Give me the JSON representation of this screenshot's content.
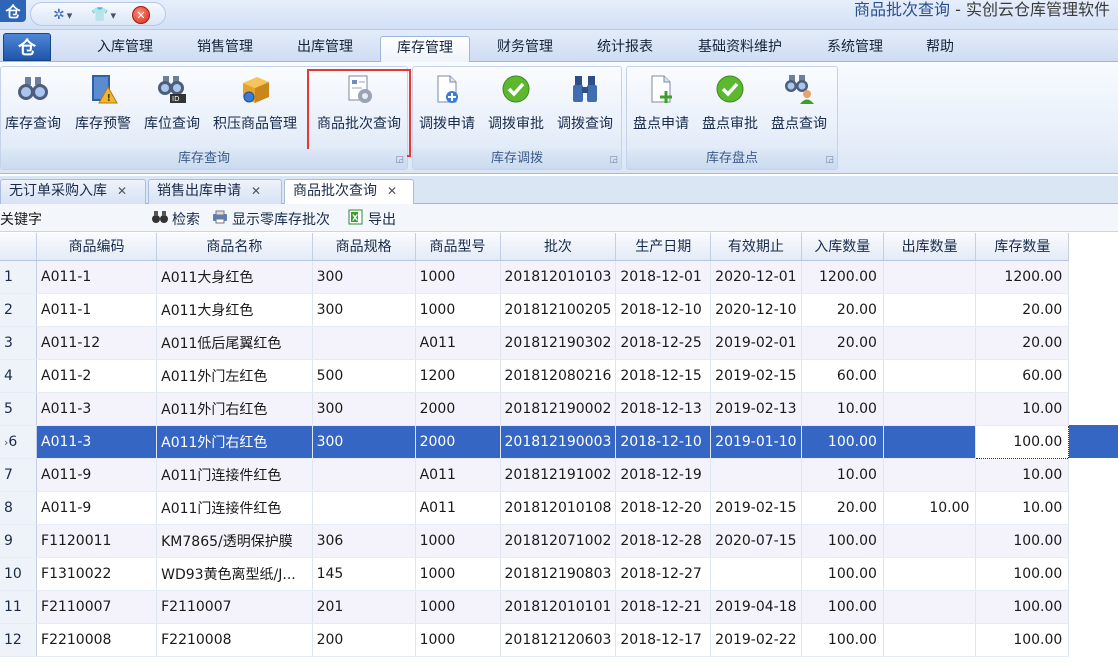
{
  "titlebar": {
    "logo": "仓",
    "title_main": "商品批次查询",
    "title_sub": " - 实创云仓库管理软件"
  },
  "menubar": {
    "app_logo": "仓",
    "tabs": [
      {
        "label": "入库管理"
      },
      {
        "label": "销售管理"
      },
      {
        "label": "出库管理"
      },
      {
        "label": "库存管理"
      },
      {
        "label": "财务管理"
      },
      {
        "label": "统计报表"
      },
      {
        "label": "基础资料维护"
      },
      {
        "label": "系统管理"
      },
      {
        "label": "帮助"
      }
    ],
    "active": "库存管理"
  },
  "ribbon": {
    "groups": [
      {
        "label": "库存查询",
        "buttons": [
          {
            "label": "库存查询",
            "icon": "binoculars-icon"
          },
          {
            "label": "库存预警",
            "icon": "warning-book-icon"
          },
          {
            "label": "库位查询",
            "icon": "binoculars-id-icon"
          },
          {
            "label": "积压商品管理",
            "icon": "box-icon"
          },
          {
            "label": "商品批次查询",
            "icon": "gear-document-icon"
          }
        ]
      },
      {
        "label": "库存调拨",
        "buttons": [
          {
            "label": "调拨申请",
            "icon": "add-document-icon"
          },
          {
            "label": "调拨审批",
            "icon": "check-circle-icon"
          },
          {
            "label": "调拨查询",
            "icon": "binoculars-icon"
          }
        ]
      },
      {
        "label": "库存盘点",
        "buttons": [
          {
            "label": "盘点申请",
            "icon": "add-document-icon"
          },
          {
            "label": "盘点审批",
            "icon": "check-circle-icon"
          },
          {
            "label": "盘点查询",
            "icon": "binoculars-person-icon"
          }
        ]
      }
    ]
  },
  "doctabs": [
    {
      "label": "无订单采购入库"
    },
    {
      "label": "销售出库申请"
    },
    {
      "label": "商品批次查询"
    }
  ],
  "toolbar": {
    "keyword_label": "关键字",
    "keyword_value": "",
    "search_label": "检索",
    "zero_stock_label": "显示零库存批次",
    "export_label": "导出"
  },
  "grid": {
    "columns": [
      "商品编码",
      "商品名称",
      "商品规格",
      "商品型号",
      "批次",
      "生产日期",
      "有效期止",
      "入库数量",
      "出库数量",
      "库存数量"
    ],
    "rows": [
      {
        "idx": "1",
        "cells": [
          "A011-1",
          "A011大身红色",
          "300",
          "1000",
          "201812010103",
          "2018-12-01",
          "2020-12-01",
          "1200.00",
          "",
          "1200.00"
        ]
      },
      {
        "idx": "2",
        "cells": [
          "A011-1",
          "A011大身红色",
          "300",
          "1000",
          "201812100205",
          "2018-12-10",
          "2020-12-10",
          "20.00",
          "",
          "20.00"
        ]
      },
      {
        "idx": "3",
        "cells": [
          "A011-12",
          "A011低后尾翼红色",
          "",
          "A011",
          "201812190302",
          "2018-12-25",
          "2019-02-01",
          "20.00",
          "",
          "20.00"
        ]
      },
      {
        "idx": "4",
        "cells": [
          "A011-2",
          "A011外门左红色",
          "500",
          "1200",
          "201812080216",
          "2018-12-15",
          "2019-02-15",
          "60.00",
          "",
          "60.00"
        ]
      },
      {
        "idx": "5",
        "cells": [
          "A011-3",
          "A011外门右红色",
          "300",
          "2000",
          "201812190002",
          "2018-12-13",
          "2019-02-13",
          "10.00",
          "",
          "10.00"
        ]
      },
      {
        "idx": "6",
        "cells": [
          "A011-3",
          "A011外门右红色",
          "300",
          "2000",
          "201812190003",
          "2018-12-10",
          "2019-01-10",
          "100.00",
          "",
          "100.00"
        ]
      },
      {
        "idx": "7",
        "cells": [
          "A011-9",
          "A011门连接件红色",
          "",
          "A011",
          "201812191002",
          "2018-12-19",
          "",
          "10.00",
          "",
          "10.00"
        ]
      },
      {
        "idx": "8",
        "cells": [
          "A011-9",
          "A011门连接件红色",
          "",
          "A011",
          "201812010108",
          "2018-12-20",
          "2019-02-15",
          "20.00",
          "10.00",
          "10.00"
        ]
      },
      {
        "idx": "9",
        "cells": [
          "F1120011",
          "KM7865/透明保护膜",
          "306",
          "1000",
          "201812071002",
          "2018-12-28",
          "2020-07-15",
          "100.00",
          "",
          "100.00"
        ]
      },
      {
        "idx": "10",
        "cells": [
          "F1310022",
          "WD93黄色离型纸/J...",
          "145",
          "1000",
          "201812190803",
          "2018-12-27",
          "",
          "100.00",
          "",
          "100.00"
        ]
      },
      {
        "idx": "11",
        "cells": [
          "F2110007",
          "F2110007",
          "201",
          "1000",
          "201812010101",
          "2018-12-21",
          "2019-04-18",
          "100.00",
          "",
          "100.00"
        ]
      },
      {
        "idx": "12",
        "cells": [
          "F2210008",
          "F2210008",
          "200",
          "1000",
          "201812120603",
          "2018-12-17",
          "2019-02-22",
          "100.00",
          "",
          "100.00"
        ]
      }
    ],
    "selected_row_marker": "›"
  },
  "colors": {
    "selection": "#3566c4",
    "ribbon_highlight": "#e53935",
    "brand": "#2f65b6"
  }
}
